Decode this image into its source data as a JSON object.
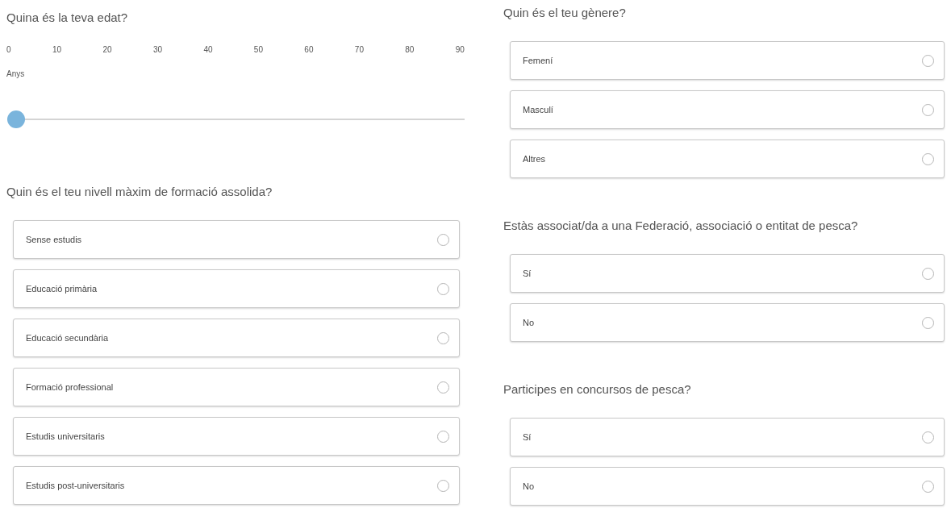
{
  "columns": [
    {
      "questions": [
        {
          "kind": "slider",
          "title": "Quina és la teva edat?",
          "ticks": [
            "0",
            "10",
            "20",
            "30",
            "40",
            "50",
            "60",
            "70",
            "80",
            "90"
          ],
          "unit": "Anys",
          "level": 0
        },
        {
          "kind": "choice",
          "title": "Quin és el teu nivell màxim de formació assolida?",
          "options": [
            {
              "label": "Sense estudis",
              "selected": false
            },
            {
              "label": "Educació primària",
              "selected": false
            },
            {
              "label": "Educació secundària",
              "selected": false
            },
            {
              "label": "Formació professional",
              "selected": false
            },
            {
              "label": "Estudis universitaris",
              "selected": false
            },
            {
              "label": "Estudis post-universitaris",
              "selected": false
            }
          ]
        }
      ]
    },
    {
      "questions": [
        {
          "kind": "choice",
          "title": "Quin és el teu gènere?",
          "options": [
            {
              "label": "Femení",
              "selected": false
            },
            {
              "label": "Masculí",
              "selected": false
            },
            {
              "label": "Altres",
              "selected": false
            }
          ]
        },
        {
          "kind": "choice",
          "title": "Estàs associat/da a una Federació, associació o entitat de pesca?",
          "options": [
            {
              "label": "Sí",
              "selected": false
            },
            {
              "label": "No",
              "selected": false
            }
          ]
        },
        {
          "kind": "choice",
          "title": "Participes en concursos de pesca?",
          "options": [
            {
              "label": "Sí",
              "selected": false
            },
            {
              "label": "No",
              "selected": false
            }
          ]
        }
      ]
    }
  ]
}
